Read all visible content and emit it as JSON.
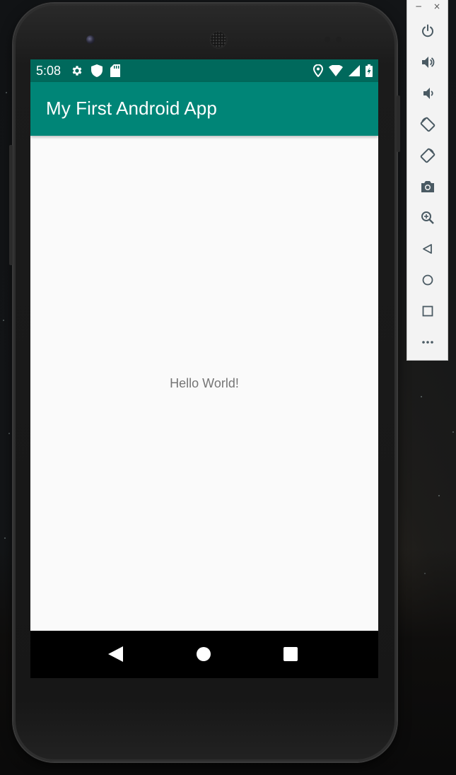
{
  "status_bar": {
    "time": "5:08",
    "left_icons": [
      "settings-icon",
      "shield-icon",
      "sd-card-icon"
    ],
    "right_icons": [
      "location-icon",
      "wifi-icon",
      "signal-icon",
      "battery-charging-icon"
    ]
  },
  "app_bar": {
    "title": "My First Android App",
    "background_color": "#008577",
    "status_color": "#00695c"
  },
  "content": {
    "hello_text": "Hello World!"
  },
  "nav_bar": {
    "buttons": [
      "back-icon",
      "home-icon",
      "recents-icon"
    ]
  },
  "emulator_toolbar": {
    "window_controls": {
      "minimize": "−",
      "close": "×"
    },
    "buttons": [
      "power-icon",
      "volume-up-icon",
      "volume-down-icon",
      "rotate-left-icon",
      "rotate-right-icon",
      "camera-icon",
      "zoom-icon",
      "back-triangle-icon",
      "home-circle-icon",
      "overview-square-icon",
      "more-icon"
    ]
  }
}
